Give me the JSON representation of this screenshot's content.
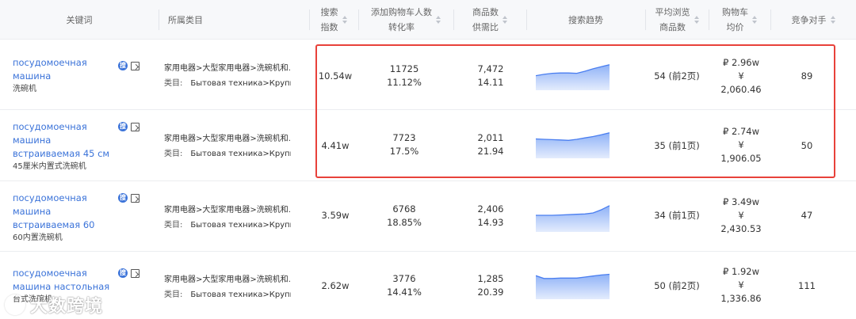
{
  "columns": [
    {
      "label": "关键词",
      "sortable": false
    },
    {
      "label": "所属类目",
      "sortable": false
    },
    {
      "label": "搜索\n指数",
      "sortable": true
    },
    {
      "label": "添加购物车人数\n转化率",
      "sortable": true
    },
    {
      "label": "商品数\n供需比",
      "sortable": true
    },
    {
      "label": "搜索趋势",
      "sortable": false
    },
    {
      "label": "平均浏览\n商品数",
      "sortable": true
    },
    {
      "label": "购物车\n均价",
      "sortable": true
    },
    {
      "label": "竞争对手",
      "sortable": true
    }
  ],
  "badge_text": "搜",
  "category_prefix": "类目:",
  "rows": [
    {
      "keyword": "посудомоечная машина",
      "keyword_cn": "洗碗机",
      "category_cn": "家用电器>大型家用电器>洗碗机和...",
      "category_ru": "Бытовая техника>Крупн...",
      "search_index": "10.54w",
      "cart_adds": "11725",
      "conversion": "11.12%",
      "products": "7,472",
      "supply_demand": "14.11",
      "trend": [
        42,
        46,
        49,
        50,
        50,
        49,
        55,
        62,
        68,
        74
      ],
      "avg_browse": "54 (前2页)",
      "price_rub": "₽ 2.96w",
      "price_cny_symbol": "¥",
      "price_cny": "2,060.46",
      "competitors": "89"
    },
    {
      "keyword": "посудомоечная машина встраиваемая 45 см",
      "keyword_cn": "45厘米内置式洗碗机",
      "category_cn": "家用电器>大型家用电器>洗碗机和...",
      "category_ru": "Бытовая техника>Крупн...",
      "search_index": "4.41w",
      "cart_adds": "7723",
      "conversion": "17.5%",
      "products": "2,011",
      "supply_demand": "21.94",
      "trend": [
        56,
        55,
        54,
        53,
        52,
        55,
        59,
        63,
        68,
        74
      ],
      "avg_browse": "35 (前1页)",
      "price_rub": "₽ 2.74w",
      "price_cny_symbol": "¥",
      "price_cny": "1,906.05",
      "competitors": "50"
    },
    {
      "keyword": "посудомоечная машина встраиваемая 60",
      "keyword_cn": "60内置洗碗机",
      "category_cn": "家用电器>大型家用电器>洗碗机和...",
      "category_ru": "Бытовая техника>Крупн...",
      "search_index": "3.59w",
      "cart_adds": "6768",
      "conversion": "18.85%",
      "products": "2,406",
      "supply_demand": "14.93",
      "trend": [
        48,
        48,
        48,
        49,
        50,
        51,
        52,
        55,
        64,
        76
      ],
      "avg_browse": "34 (前1页)",
      "price_rub": "₽ 3.49w",
      "price_cny_symbol": "¥",
      "price_cny": "2,430.53",
      "competitors": "47"
    },
    {
      "keyword": "посудомоечная машина настольная",
      "keyword_cn": "台式洗碗机",
      "category_cn": "家用电器>大型家用电器>洗碗机和...",
      "category_ru": "Бытовая техника>Крупн...",
      "search_index": "2.62w",
      "cart_adds": "3776",
      "conversion": "14.41%",
      "products": "1,285",
      "supply_demand": "20.39",
      "trend": [
        68,
        60,
        60,
        61,
        61,
        61,
        64,
        67,
        70,
        72
      ],
      "avg_browse": "50 (前2页)",
      "price_rub": "₽ 1.92w",
      "price_cny_symbol": "¥",
      "price_cny": "1,336.86",
      "competitors": "111"
    }
  ],
  "watermark": "大数跨境",
  "colors": {
    "link": "#3b73d9",
    "highlight": "#e8413a",
    "trend_line": "#4a7ef0",
    "trend_fill_top": "#8fb2f7",
    "trend_fill_bottom": "#e4ecfd"
  }
}
